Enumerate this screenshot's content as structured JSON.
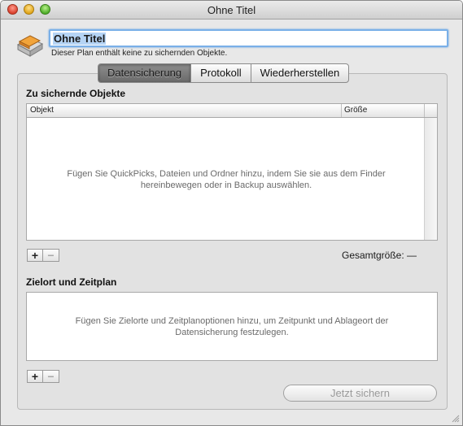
{
  "window": {
    "title": "Ohne Titel"
  },
  "plan": {
    "name": "Ohne Titel",
    "status": "Dieser Plan enthält keine zu sichernden Objekte."
  },
  "tabs": [
    {
      "label": "Datensicherung",
      "active": true
    },
    {
      "label": "Protokoll",
      "active": false
    },
    {
      "label": "Wiederherstellen",
      "active": false
    }
  ],
  "objects_section": {
    "heading": "Zu sichernde Objekte",
    "columns": [
      "Objekt",
      "Größe"
    ],
    "empty_hint_line1": "Fügen Sie QuickPicks, Dateien und Ordner hinzu, indem Sie sie aus dem Finder",
    "empty_hint_line2": "hereinbewegen oder in Backup auswählen.",
    "add_label": "+",
    "remove_label": "−",
    "total_label": "Gesamtgröße: —"
  },
  "destination_section": {
    "heading": "Zielort und Zeitplan",
    "empty_hint_line1": "Fügen Sie Zielorte und Zeitplanoptionen hinzu, um Zeitpunkt und Ablageort der",
    "empty_hint_line2": "Datensicherung festzulegen.",
    "add_label": "+",
    "remove_label": "−"
  },
  "actions": {
    "backup_now_label": "Jetzt sichern"
  },
  "colors": {
    "window_bg": "#e8e8e8",
    "focus_ring": "#7ab0e8",
    "text_selection": "#b5d4f5",
    "active_tab": "#7a7a7a"
  },
  "icons": {
    "app": "backup-app-icon",
    "close": "close-window-icon",
    "minimize": "minimize-window-icon",
    "zoom": "zoom-window-icon",
    "resize": "resize-grip-icon"
  }
}
